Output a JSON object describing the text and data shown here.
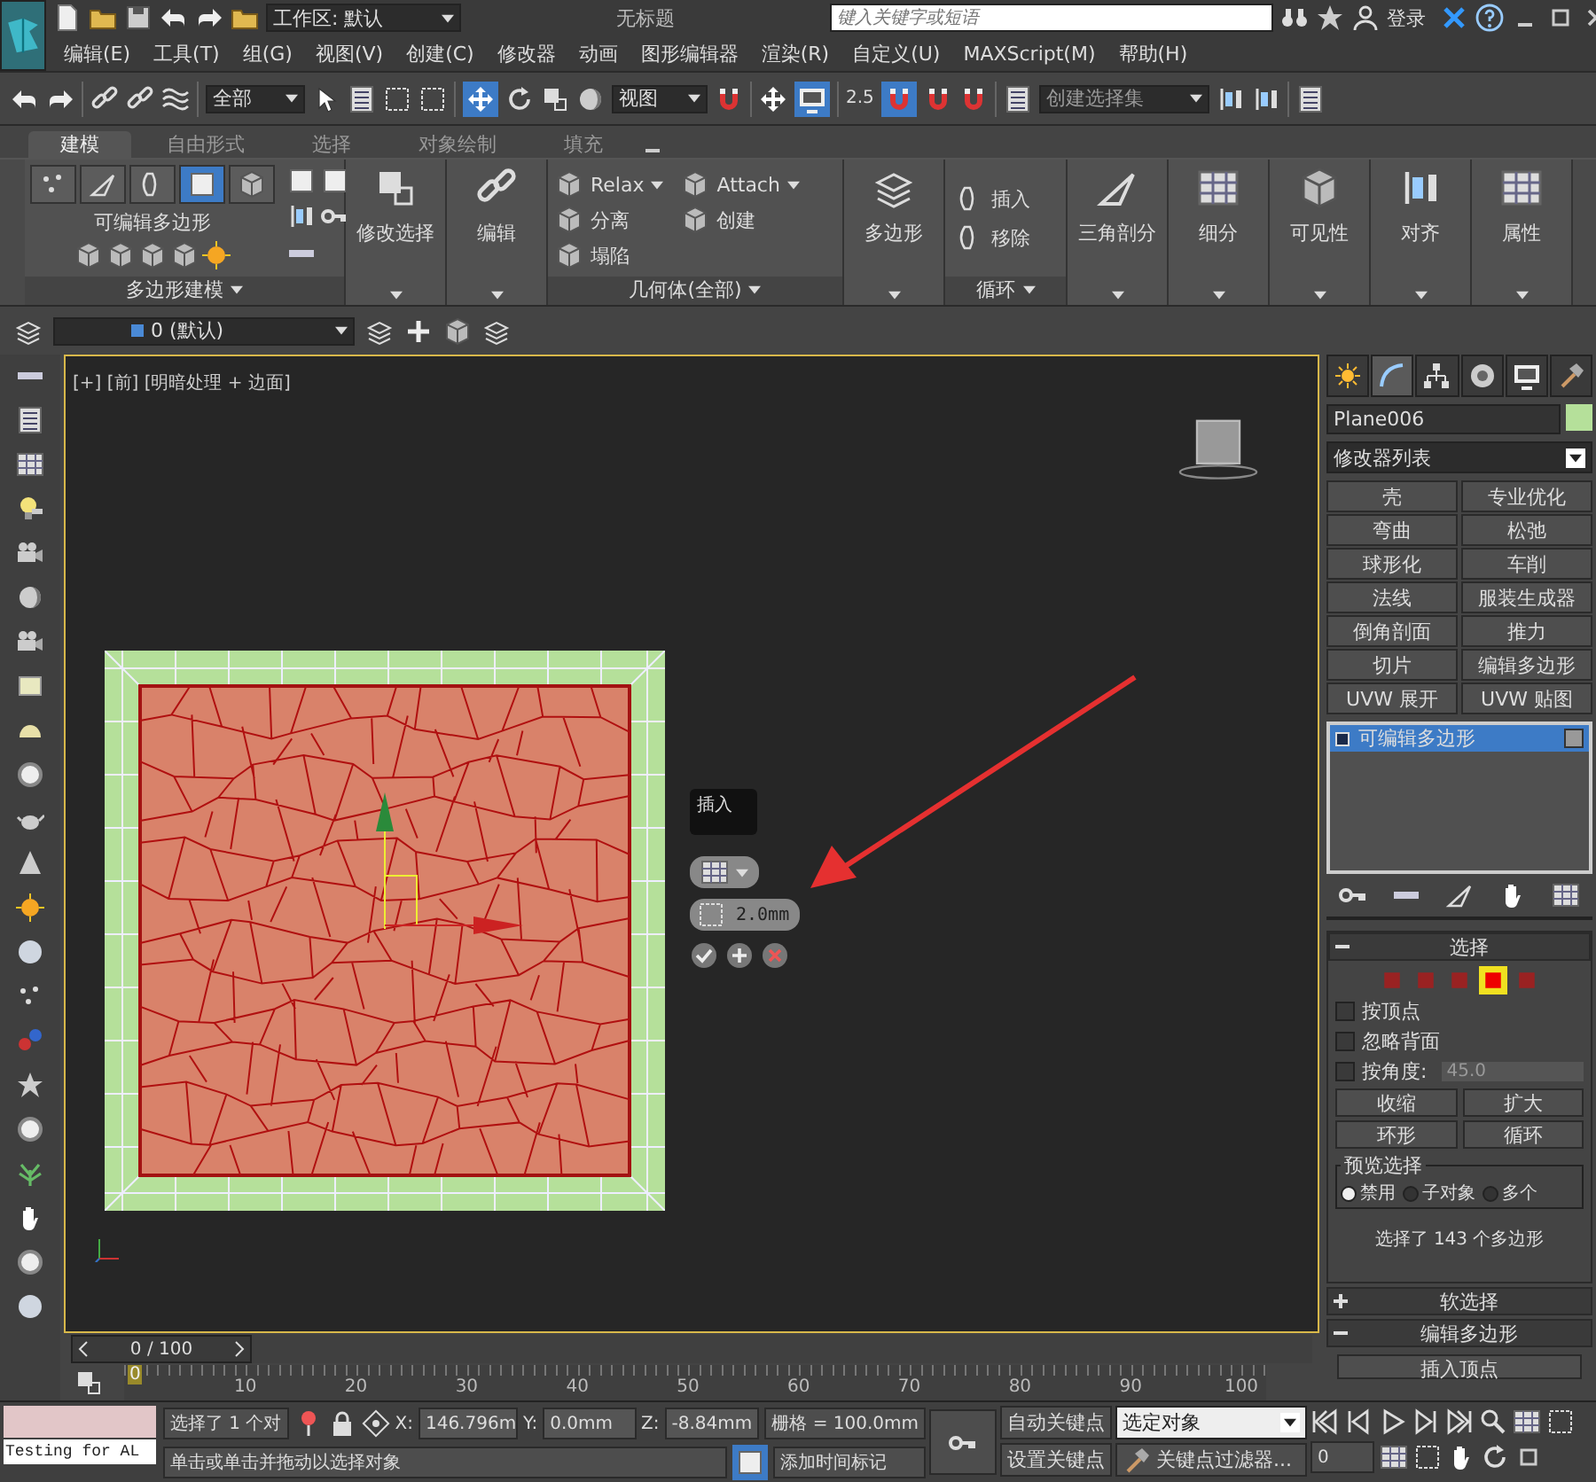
{
  "title_bar": {
    "workspace": "工作区: 默认",
    "title": "无标题",
    "search_placeholder": "键入关键字或短语",
    "login": "登录"
  },
  "menu": [
    "编辑(E)",
    "工具(T)",
    "组(G)",
    "视图(V)",
    "创建(C)",
    "修改器",
    "动画",
    "图形编辑器",
    "渲染(R)",
    "自定义(U)",
    "MAXScript(M)",
    "帮助(H)"
  ],
  "main_toolbar": {
    "selection_filter": "全部",
    "reference_coordinate": "视图",
    "snap_value": "2.5",
    "named_selection": "创建选择集",
    "move_selected": true,
    "manipulate_selected": true,
    "angle_snap_selected": true
  },
  "ribbon": {
    "tabs": [
      {
        "label": "建模",
        "selected": true
      },
      {
        "label": "自由形式",
        "selected": false
      },
      {
        "label": "选择",
        "selected": false
      },
      {
        "label": "对象绘制",
        "selected": false
      },
      {
        "label": "填充",
        "selected": false
      }
    ],
    "polygon_modeling": {
      "object_type": "可编辑多边形",
      "levels": [
        {
          "selected": false
        },
        {
          "selected": false
        },
        {
          "selected": false
        },
        {
          "selected": true
        },
        {
          "selected": false
        }
      ],
      "footer": "多边形建模"
    },
    "modify_selection": "修改选择",
    "edit": "编辑",
    "geometry": {
      "items": [
        {
          "label": "Relax",
          "has_menu": true
        },
        {
          "label": "Attach",
          "has_menu": true
        },
        {
          "label": "分离",
          "has_menu": false
        },
        {
          "label": "创建",
          "has_menu": false
        },
        {
          "label": "塌陷",
          "has_menu": false
        }
      ],
      "footer": "几何体(全部)"
    },
    "polygons": "多边形",
    "loops": {
      "items": [
        "插入",
        "移除"
      ],
      "footer": "循环"
    },
    "tools": [
      "三角剖分",
      "细分",
      "可见性",
      "对齐",
      "属性"
    ]
  },
  "layer_bar": {
    "layer": "0 (默认)"
  },
  "viewport": {
    "label": "[+] [前] [明暗处理 + 边面]",
    "caddy": {
      "title": "插入",
      "value": "2.0mm"
    }
  },
  "command_panel": {
    "tabs": [
      {
        "selected": false
      },
      {
        "selected": true
      },
      {
        "selected": false
      },
      {
        "selected": false
      },
      {
        "selected": false
      },
      {
        "selected": false
      }
    ],
    "object_name": "Plane006",
    "modifier_list": "修改器列表",
    "modifier_buttons": [
      "壳",
      "专业优化",
      "弯曲",
      "松弛",
      "球形化",
      "车削",
      "法线",
      "服装生成器",
      "倒角剖面",
      "推力",
      "切片",
      "编辑多边形",
      "UVW 展开",
      "UVW 贴图"
    ],
    "stack": [
      {
        "label": "可编辑多边形",
        "selected": true
      }
    ],
    "selection_rollout": {
      "title": "选择",
      "expanded": true,
      "levels": [
        {
          "selected": false
        },
        {
          "selected": false
        },
        {
          "selected": false
        },
        {
          "selected": true
        },
        {
          "selected": false
        }
      ],
      "options": [
        {
          "label": "按顶点",
          "checked": false
        },
        {
          "label": "忽略背面",
          "checked": false
        },
        {
          "label": "按角度:",
          "checked": false
        }
      ],
      "angle": "45.0",
      "buttons": [
        "收缩",
        "扩大"
      ],
      "spinner_buttons": [
        "环形",
        "循环"
      ],
      "preview": {
        "title": "预览选择",
        "options": [
          {
            "label": "禁用",
            "selected": true
          },
          {
            "label": "子对象",
            "selected": false
          },
          {
            "label": "多个",
            "selected": false
          }
        ]
      },
      "status": "选择了 143 个多边形"
    },
    "rollouts": [
      {
        "title": "软选择",
        "expanded": false
      },
      {
        "title": "编辑多边形",
        "expanded": true
      }
    ],
    "edit_poly_button": "插入顶点"
  },
  "time_slider": {
    "position": "0 / 100",
    "level": 0
  },
  "track_bar": {
    "current": "0",
    "labels": [
      "10",
      "20",
      "30",
      "40",
      "50",
      "60",
      "70",
      "80",
      "90",
      "100"
    ]
  },
  "status_bar": {
    "listener": "Testing for AL",
    "selection": "选择了 1 个对",
    "coords": [
      {
        "label": "X:",
        "value": "146.796m"
      },
      {
        "label": "Y:",
        "value": "0.0mm"
      },
      {
        "label": "Z:",
        "value": "-8.84mm"
      }
    ],
    "grid": "栅格 = 100.0mm",
    "prompt": "单击或单击并拖动以选择对象",
    "add_time_tag": "添加时间标记",
    "auto_key": "自动关键点",
    "set_key": "设置关键点",
    "key_mode": "选定对象",
    "key_filters": "关键点过滤器...",
    "frame": "0"
  }
}
